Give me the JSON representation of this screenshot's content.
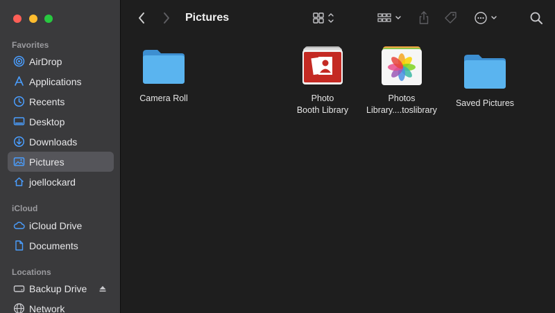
{
  "window": {
    "title": "Pictures"
  },
  "sidebar": {
    "sections": [
      {
        "label": "Favorites",
        "items": [
          {
            "label": "AirDrop",
            "icon": "airdrop-icon"
          },
          {
            "label": "Applications",
            "icon": "applications-icon"
          },
          {
            "label": "Recents",
            "icon": "clock-icon"
          },
          {
            "label": "Desktop",
            "icon": "desktop-icon"
          },
          {
            "label": "Downloads",
            "icon": "download-icon"
          },
          {
            "label": "Pictures",
            "icon": "pictures-icon",
            "selected": true
          },
          {
            "label": "joellockard",
            "icon": "home-icon"
          }
        ]
      },
      {
        "label": "iCloud",
        "items": [
          {
            "label": "iCloud Drive",
            "icon": "cloud-icon"
          },
          {
            "label": "Documents",
            "icon": "document-icon"
          }
        ]
      },
      {
        "label": "Locations",
        "items": [
          {
            "label": "Backup Drive",
            "icon": "drive-icon",
            "ejectable": true
          },
          {
            "label": "Network",
            "icon": "network-icon"
          }
        ]
      }
    ]
  },
  "files": [
    {
      "name": "Camera Roll",
      "kind": "folder"
    },
    {
      "name": "Photo Booth Library",
      "kind": "photo-booth"
    },
    {
      "name": "Photos Library....toslibrary",
      "kind": "photos-library"
    },
    {
      "name": "Saved Pictures",
      "kind": "folder"
    }
  ],
  "colors": {
    "accent": "#4a9eff",
    "folder": "#5ab4ef",
    "sidebar_bg": "#3a3a3c",
    "content_bg": "#1e1e1e",
    "selection": "#55555a"
  }
}
